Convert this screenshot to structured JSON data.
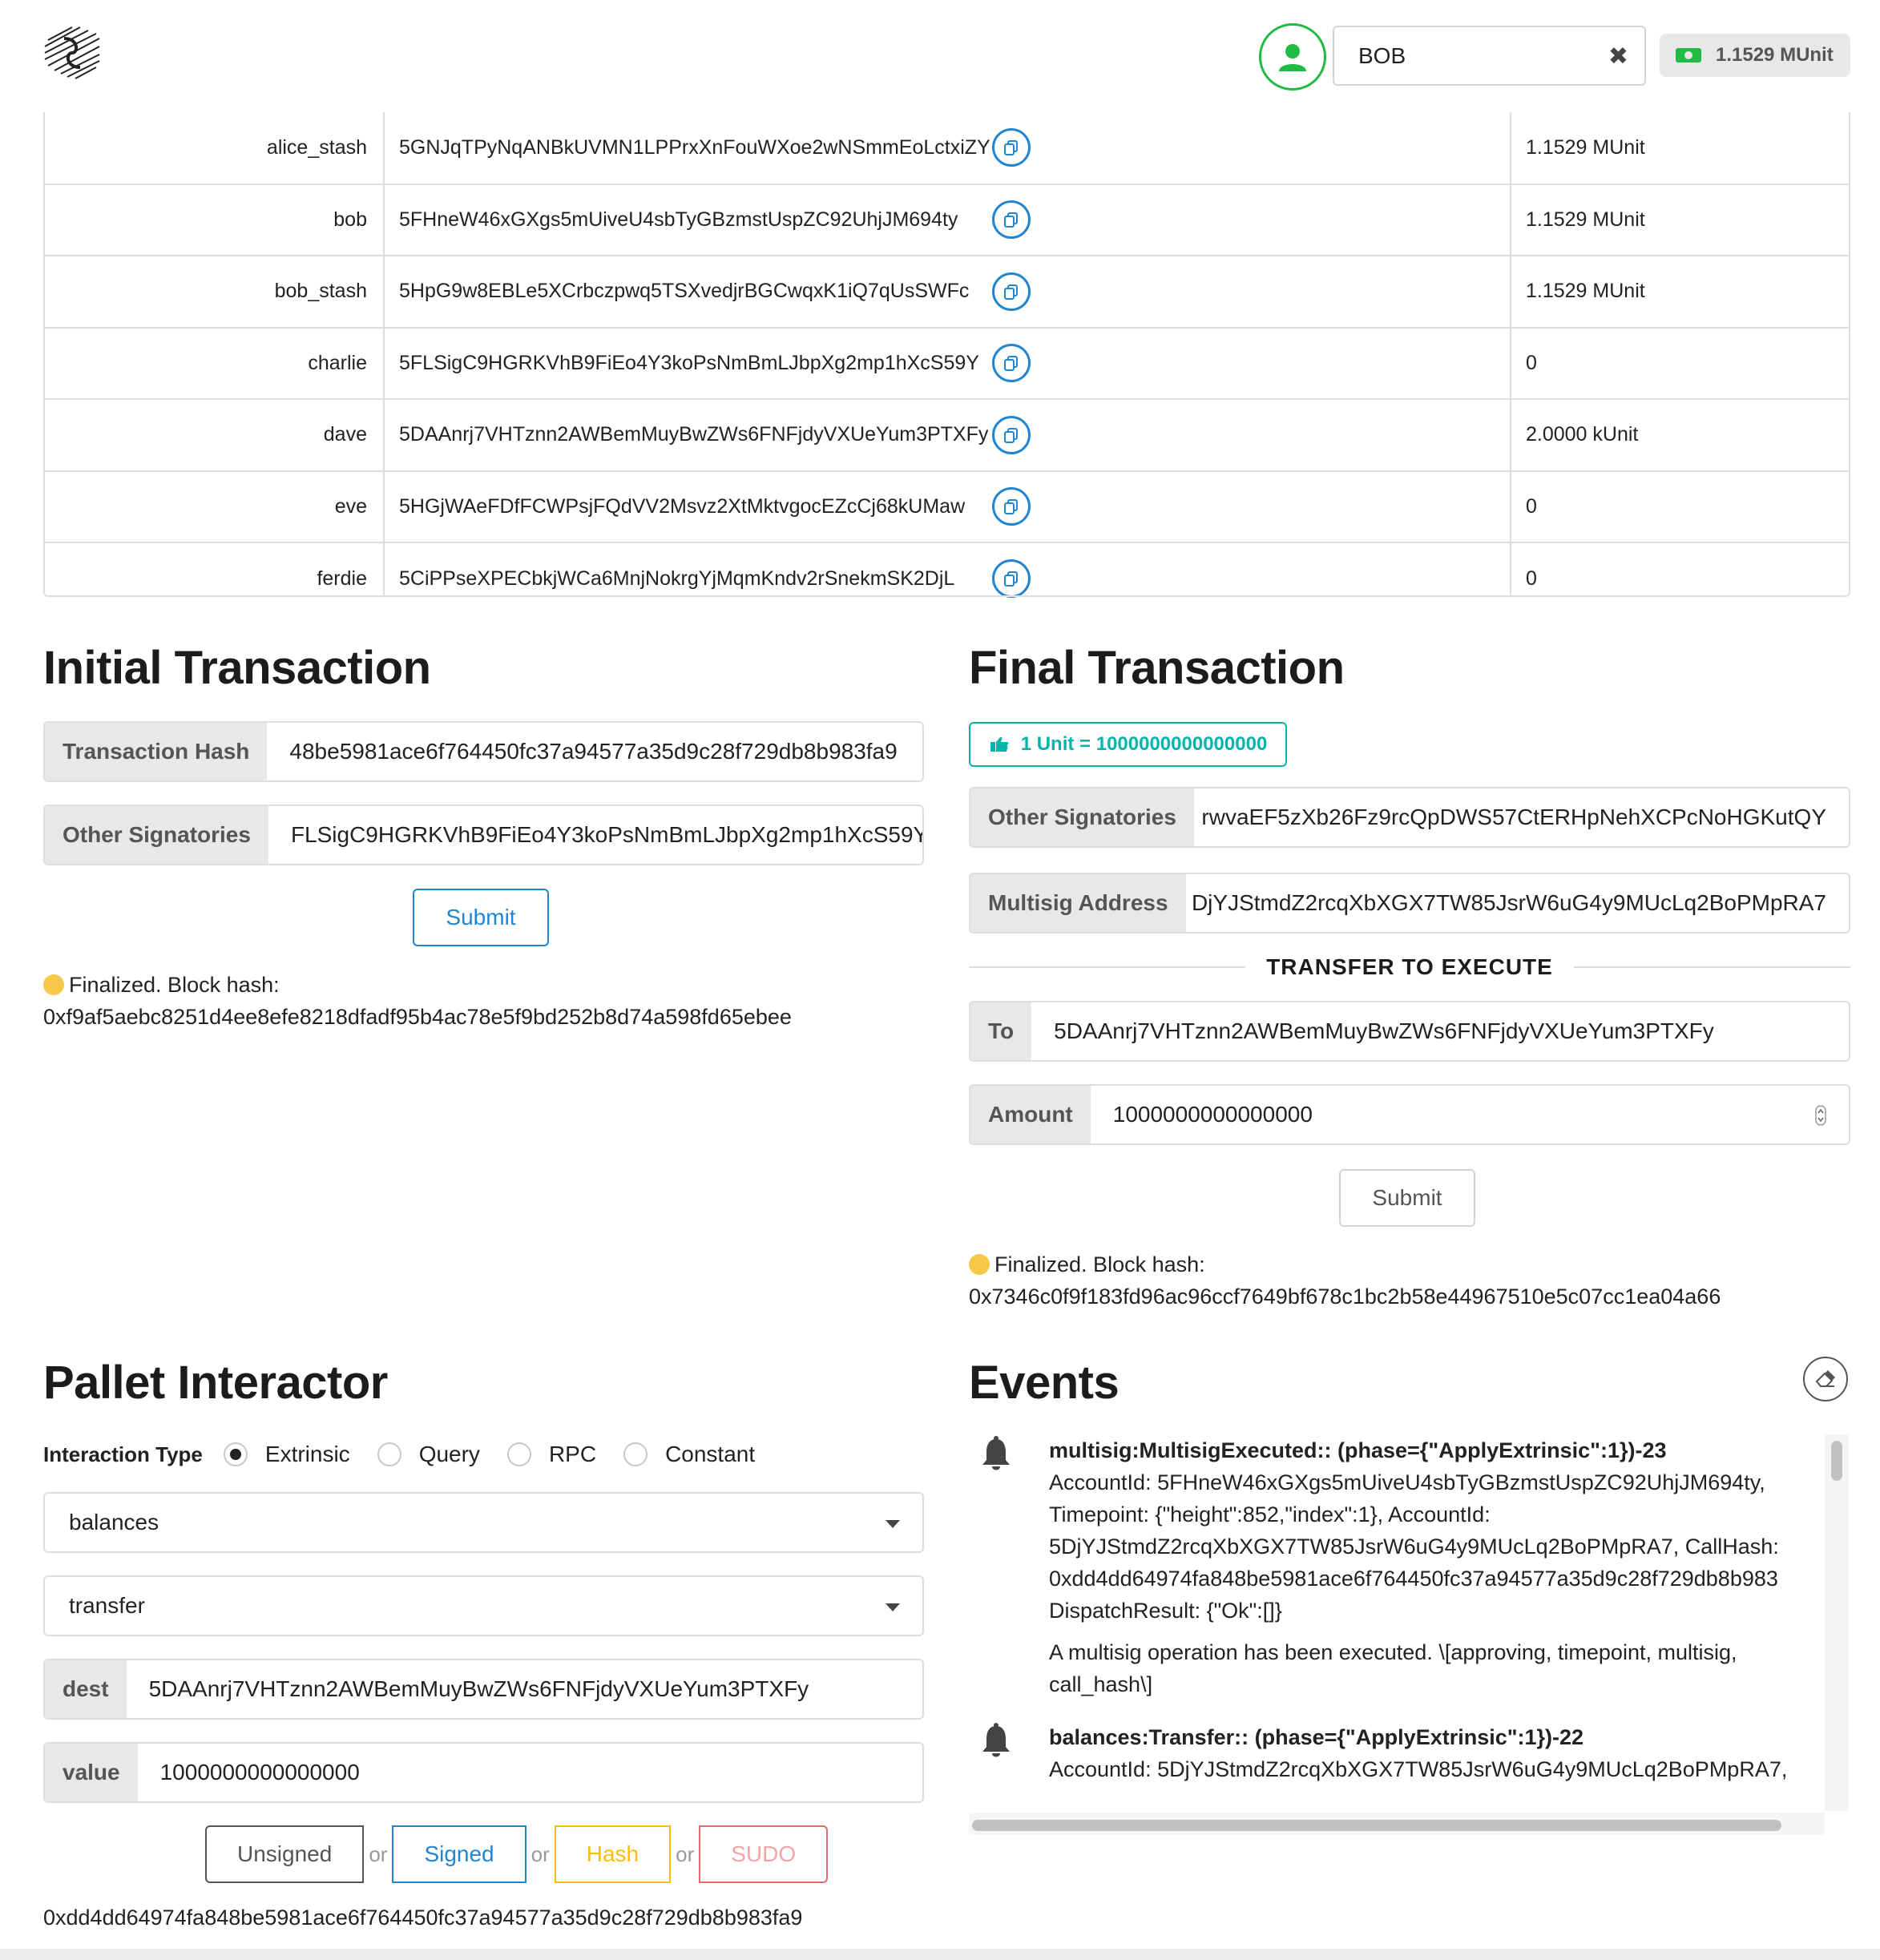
{
  "header": {
    "account": "BOB",
    "balance": "1.1529 MUnit"
  },
  "accounts": [
    {
      "name": "alice_stash",
      "address": "5GNJqTPyNqANBkUVMN1LPPrxXnFouWXoe2wNSmmEoLctxiZY",
      "balance": "1.1529 MUnit"
    },
    {
      "name": "bob",
      "address": "5FHneW46xGXgs5mUiveU4sbTyGBzmstUspZC92UhjJM694ty",
      "balance": "1.1529 MUnit"
    },
    {
      "name": "bob_stash",
      "address": "5HpG9w8EBLe5XCrbczpwq5TSXvedjrBGCwqxK1iQ7qUsSWFc",
      "balance": "1.1529 MUnit"
    },
    {
      "name": "charlie",
      "address": "5FLSigC9HGRKVhB9FiEo4Y3koPsNmBmLJbpXg2mp1hXcS59Y",
      "balance": "0"
    },
    {
      "name": "dave",
      "address": "5DAAnrj7VHTznn2AWBemMuyBwZWs6FNFjdyVXUeYum3PTXFy",
      "balance": "2.0000 kUnit"
    },
    {
      "name": "eve",
      "address": "5HGjWAeFDfFCWPsjFQdVV2Msvz2XtMktvgocEZcCj68kUMaw",
      "balance": "0"
    },
    {
      "name": "ferdie",
      "address": "5CiPPseXPECbkjWCa6MnjNokrgYjMqmKndv2rSnekmSK2DjL",
      "balance": "0"
    }
  ],
  "initial": {
    "title": "Initial Transaction",
    "hash_label": "Transaction Hash",
    "hash_value": "48be5981ace6f764450fc37a94577a35d9c28f729db8b983fa9",
    "signatories_label": "Other Signatories",
    "signatories_value": "FLSigC9HGRKVhB9FiEo4Y3koPsNmBmLJbpXg2mp1hXcS59Y",
    "submit": "Submit",
    "status_line1": "Finalized. Block hash:",
    "status_line2": "0xf9af5aebc8251d4ee8efe8218dfadf95b4ac78e5f9bd252b8d74a598fd65ebee"
  },
  "final": {
    "title": "Final Transaction",
    "unit_label": "1 Unit = 1000000000000000",
    "signatories_label": "Other Signatories",
    "signatories_value": "rwvaEF5zXb26Fz9rcQpDWS57CtERHpNehXCPcNoHGKutQY",
    "multisig_label": "Multisig Address",
    "multisig_value": "DjYJStmdZ2rcqXbXGX7TW85JsrW6uG4y9MUcLq2BoPMpRA7",
    "divider": "TRANSFER TO EXECUTE",
    "to_label": "To",
    "to_value": "5DAAnrj7VHTznn2AWBemMuyBwZWs6FNFjdyVXUeYum3PTXFy",
    "amount_label": "Amount",
    "amount_value": "1000000000000000",
    "submit": "Submit",
    "status_line1": "Finalized. Block hash:",
    "status_line2": "0x7346c0f9f183fd96ac96ccf7649bf678c1bc2b58e44967510e5c07cc1ea04a66"
  },
  "pallet": {
    "title": "Pallet Interactor",
    "interaction_label": "Interaction Type",
    "options": [
      "Extrinsic",
      "Query",
      "RPC",
      "Constant"
    ],
    "selected": "Extrinsic",
    "pallet_value": "balances",
    "call_value": "transfer",
    "dest_label": "dest",
    "dest_value": "5DAAnrj7VHTznn2AWBemMuyBwZWs6FNFjdyVXUeYum3PTXFy",
    "value_label": "value",
    "value_value": "1000000000000000",
    "buttons": {
      "unsigned": "Unsigned",
      "signed": "Signed",
      "hash": "Hash",
      "sudo": "SUDO",
      "or": "or"
    },
    "result": "0xdd4dd64974fa848be5981ace6f764450fc37a94577a35d9c28f729db8b983fa9"
  },
  "events": {
    "title": "Events",
    "items": [
      {
        "head": "multisig:MultisigExecuted:: (phase={\"ApplyExtrinsic\":1})-23",
        "lines": [
          "AccountId: 5FHneW46xGXgs5mUiveU4sbTyGBzmstUspZC92UhjJM694ty,",
          "Timepoint: {\"height\":852,\"index\":1}, AccountId:",
          "5DjYJStmdZ2rcqXbXGX7TW85JsrW6uG4y9MUcLq2BoPMpRA7, CallHash:",
          "0xdd4dd64974fa848be5981ace6f764450fc37a94577a35d9c28f729db8b983",
          "DispatchResult: {\"Ok\":[]}"
        ],
        "desc": "A multisig operation has been executed. \\[approving, timepoint, multisig, call_hash\\]"
      },
      {
        "head": "balances:Transfer:: (phase={\"ApplyExtrinsic\":1})-22",
        "lines": [
          "AccountId: 5DjYJStmdZ2rcqXbXGX7TW85JsrW6uG4y9MUcLq2BoPMpRA7,"
        ],
        "desc": ""
      }
    ]
  },
  "colors": {
    "primary": "#2185d0",
    "teal": "#00b5ad",
    "green": "#21ba45",
    "yellow": "#fbbd08",
    "red": "#db2828"
  }
}
